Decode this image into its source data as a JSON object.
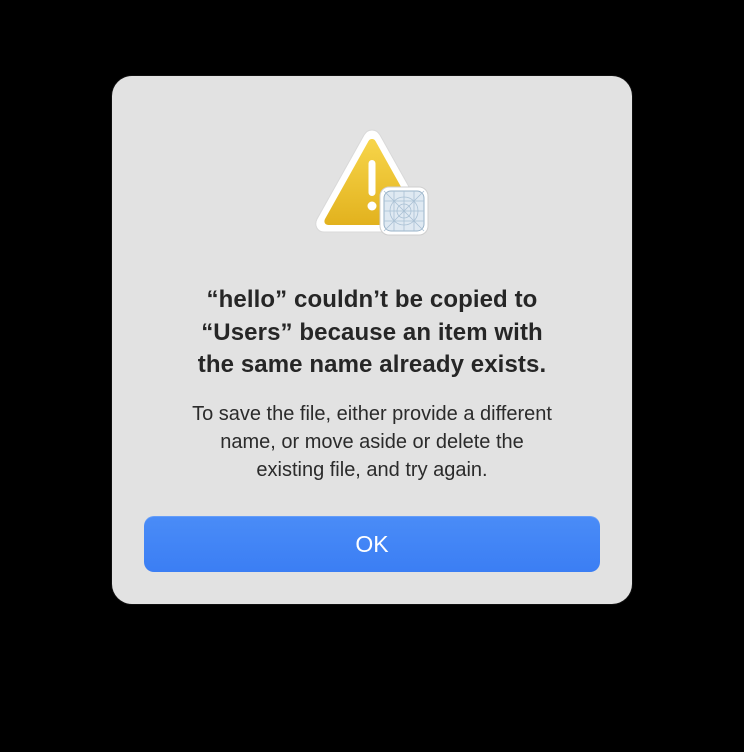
{
  "dialog": {
    "icon": {
      "primary": "warning-triangle-icon",
      "badge": "app-generic-icon",
      "warning_color": "#f0c731",
      "border_color": "#ffffff"
    },
    "title_lines": [
      "“hello” couldn’t be copied to",
      "“Users” because an item with",
      "the same name already exists."
    ],
    "message_lines": [
      "To save the file, either provide a different",
      "name, or move aside or delete the",
      "existing file, and try again."
    ],
    "ok_label": "OK",
    "accent_color": "#3d82f5"
  }
}
